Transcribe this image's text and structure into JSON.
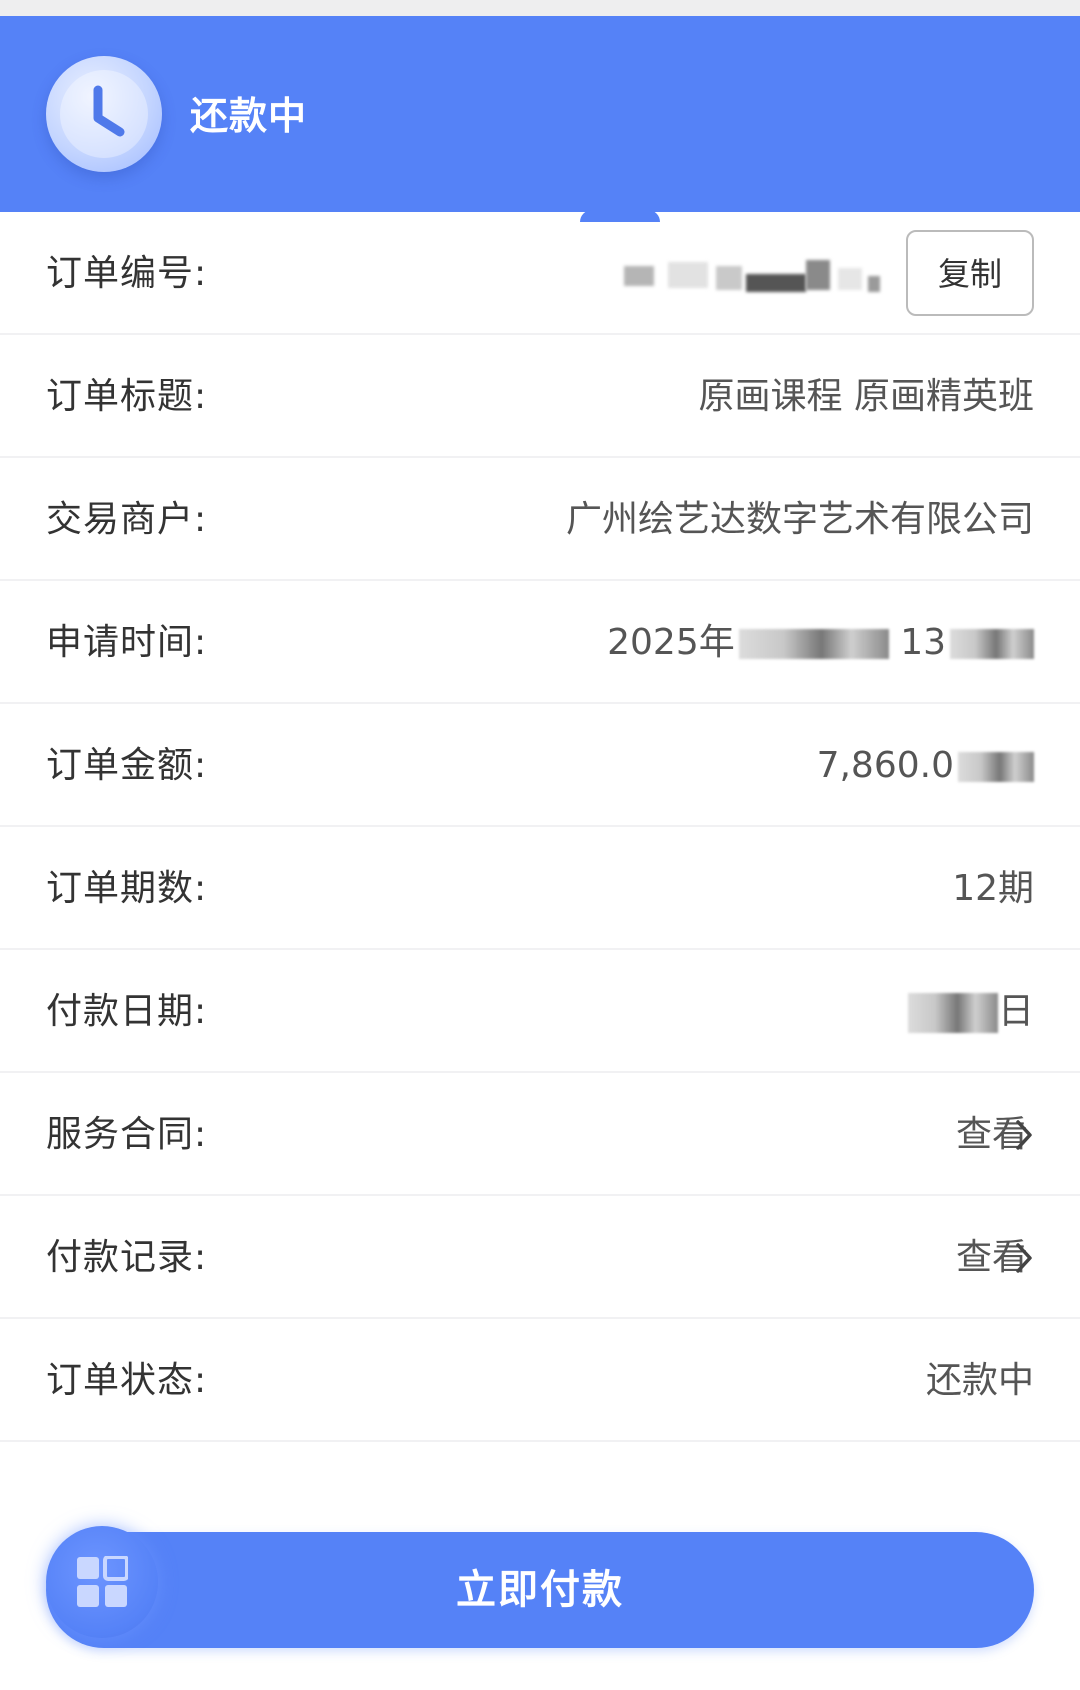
{
  "header": {
    "title": "还款中",
    "icon": "clock-icon",
    "background_color": "#5582f7"
  },
  "order_rows": [
    {
      "label": "订单编号:",
      "value": "",
      "masked": true,
      "action": "复制"
    },
    {
      "label": "订单标题:",
      "value": "原画课程 原画精英班"
    },
    {
      "label": "交易商户:",
      "value": "广州绘艺达数字艺术有限公司"
    },
    {
      "label": "申请时间:",
      "value_prefix": "2025年",
      "value_middle": "13",
      "masked": true
    },
    {
      "label": "订单金额:",
      "value_prefix": "7,860.0",
      "masked": true
    },
    {
      "label": "订单期数:",
      "value": "12期"
    },
    {
      "label": "付款日期:",
      "value_suffix": "日",
      "masked": true
    },
    {
      "label": "服务合同:",
      "value": "查看",
      "icon": "chevron-right-icon"
    },
    {
      "label": "付款记录:",
      "value": "查看",
      "icon": "chevron-right-icon"
    },
    {
      "label": "订单状态:",
      "value": "还款中"
    }
  ],
  "footer": {
    "pay_button_label": "立即付款",
    "menu_icon": "grid-menu-icon",
    "accent_color": "#5582f7"
  }
}
